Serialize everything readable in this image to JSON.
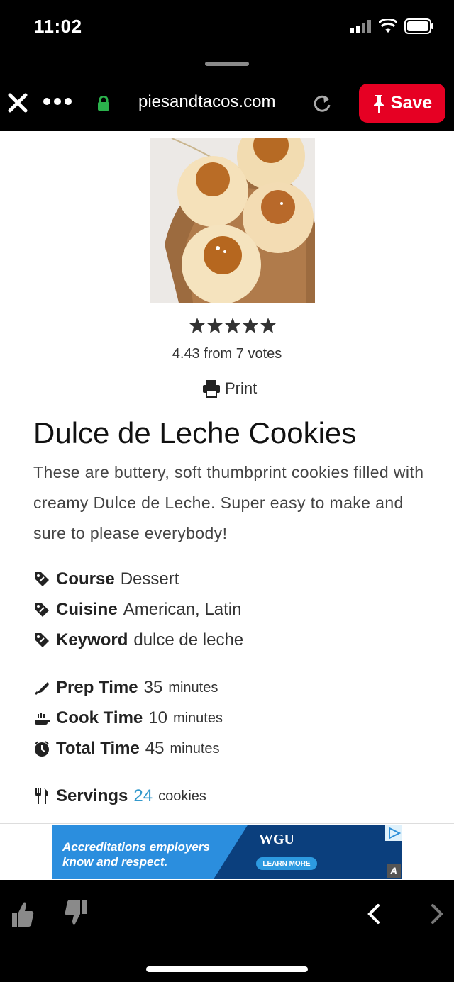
{
  "status_bar": {
    "time": "11:02"
  },
  "browser": {
    "url": "piesandtacos.com",
    "save_label": "Save"
  },
  "recipe": {
    "rating_text": "4.43 from 7 votes",
    "print_label": "Print",
    "title": "Dulce de Leche Cookies",
    "description": "These are buttery, soft thumbprint cookies filled with creamy Dulce de Leche. Super easy to make and sure to please everybody!",
    "course": {
      "label": "Course",
      "value": "Dessert"
    },
    "cuisine": {
      "label": "Cuisine",
      "value": "American, Latin"
    },
    "keyword": {
      "label": "Keyword",
      "value": "dulce de leche"
    },
    "prep_time": {
      "label": "Prep Time",
      "value": "35",
      "unit": "minutes"
    },
    "cook_time": {
      "label": "Cook Time",
      "value": "10",
      "unit": "minutes"
    },
    "total_time": {
      "label": "Total Time",
      "value": "45",
      "unit": "minutes"
    },
    "servings": {
      "label": "Servings",
      "value": "24",
      "unit": "cookies"
    }
  },
  "ad": {
    "headline": "Accreditations employers know and respect.",
    "brand": "WGU",
    "cta": "LEARN MORE"
  },
  "colors": {
    "save_red": "#e60023",
    "link_blue": "#3399cc",
    "ad_blue": "#2b8ede"
  }
}
